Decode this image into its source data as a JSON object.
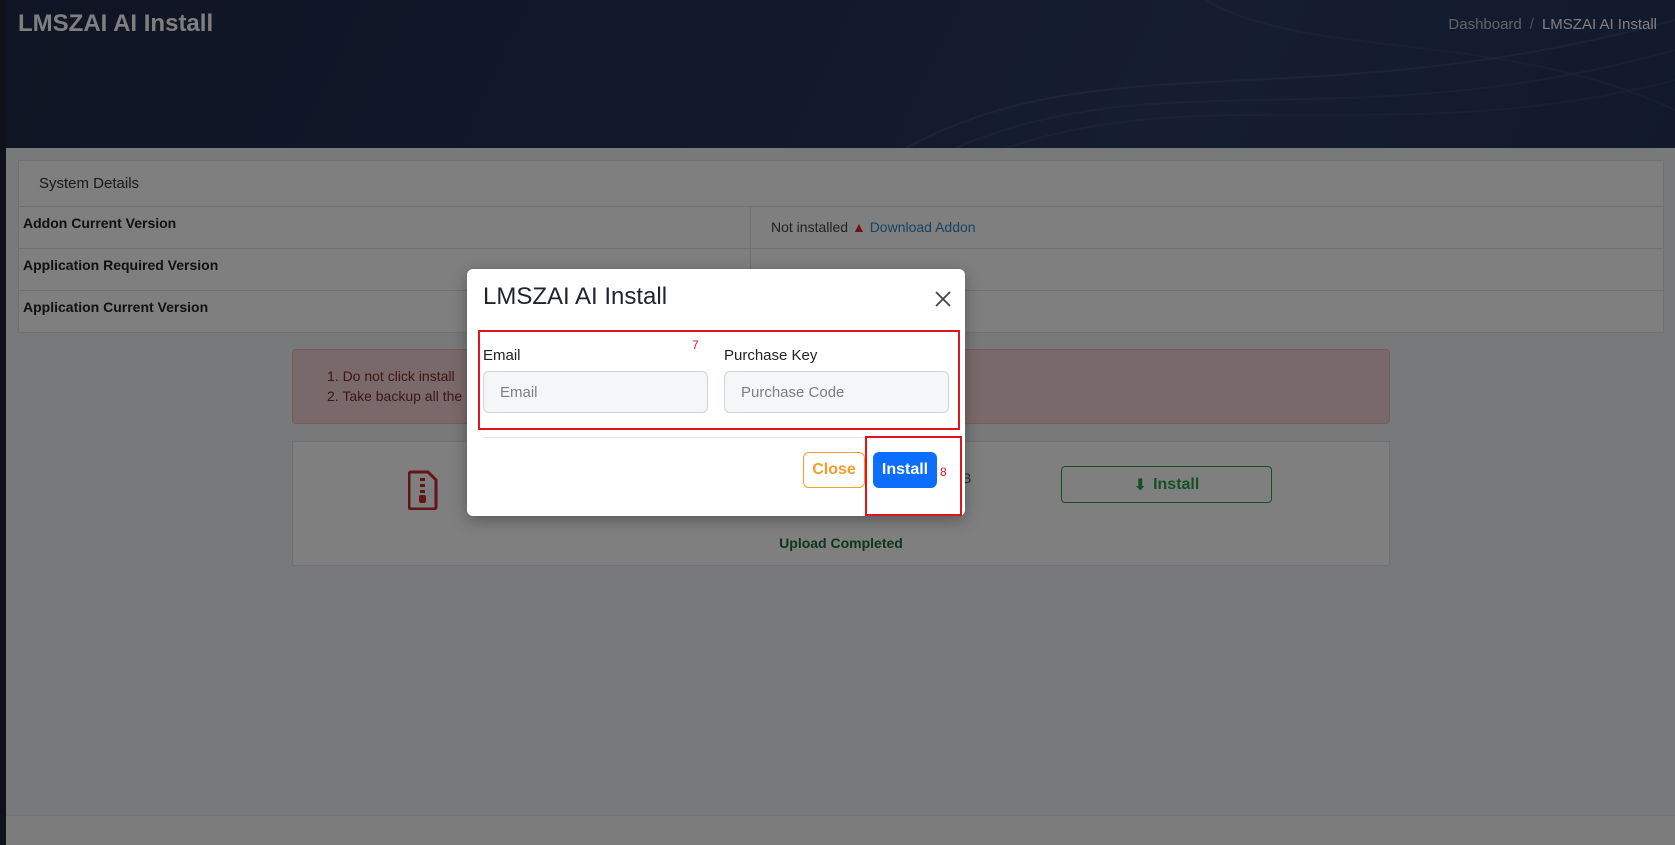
{
  "page": {
    "title": "LMSZAI AI Install",
    "breadcrumb": {
      "home": "Dashboard",
      "separator": "/",
      "current": "LMSZAI AI Install"
    }
  },
  "system_details": {
    "header": "System Details",
    "rows": [
      {
        "label": "Addon Current Version",
        "value": "Not installed",
        "link": "Download Addon"
      },
      {
        "label": "Application Required Version",
        "value": ""
      },
      {
        "label": "Application Current Version",
        "value": ""
      }
    ]
  },
  "alert": {
    "items": [
      "1. Do not click install",
      "2. Take backup all the"
    ]
  },
  "upload": {
    "file_size": ".5KB",
    "install_label": "Install",
    "status": "Upload Completed"
  },
  "modal": {
    "title": "LMSZAI AI Install",
    "email_label": "Email",
    "email_placeholder": "Email",
    "email_value": "",
    "key_label": "Purchase Key",
    "key_placeholder": "Purchase Code",
    "key_value": "",
    "close_label": "Close",
    "install_label": "Install",
    "markers": {
      "fields": "7",
      "install": "8"
    }
  },
  "colors": {
    "primary": "#0d6efd",
    "warning": "#f39c2a",
    "success": "#2e9e4a",
    "danger": "#e0151b",
    "hero": "#243256"
  },
  "icons": {
    "close": "close-icon",
    "zip_file": "zip-file-icon",
    "download": "download-icon",
    "warning": "warning-icon"
  }
}
